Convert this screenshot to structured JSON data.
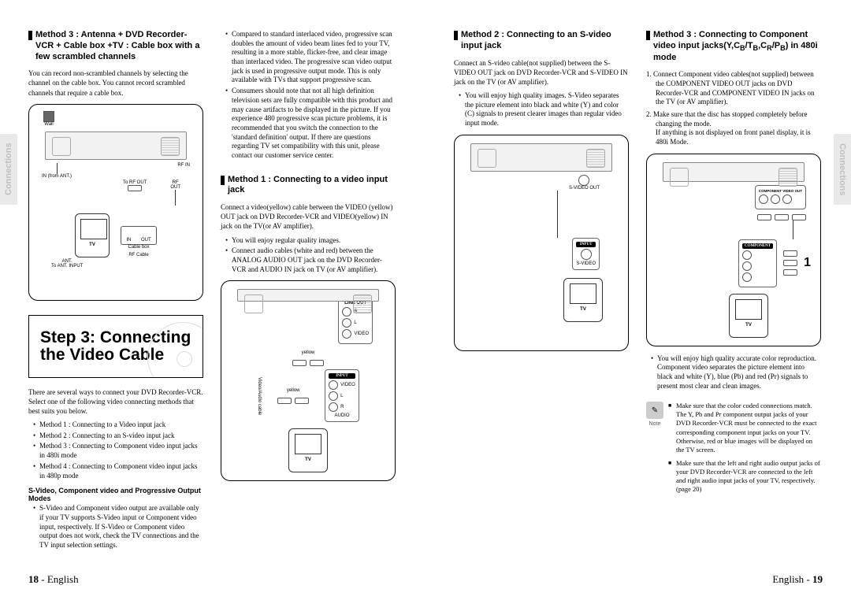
{
  "sideTab": "Connections",
  "pageLeftNum": "18",
  "pageRightNum": "19",
  "pageLang": "English",
  "left": {
    "col1": {
      "heading": "Method 3 : Antenna + DVD Recorder-VCR + Cable box +TV : Cable box with a few scrambled channels",
      "para": "You can record non-scrambled channels by selecting the channel on the cable box. You cannot record scrambled channels that require a cable box.",
      "fig": {
        "wall": "Wall",
        "in_label": "IN (from ANT.)",
        "rfin": "RF IN",
        "rf": "RF",
        "torf": "To RF OUT",
        "out": "OUT",
        "rfcable": "RF Cable",
        "cablebox": "Cable box",
        "in": "IN",
        "out2": "OUT",
        "tv": "TV",
        "ant": "ANT.",
        "toant": "To ANT. INPUT"
      },
      "stepTitle": "Step 3: Connecting the Video Cable",
      "para2": "There are several ways to connect your DVD Recorder-VCR. Select one of the following video connecting methods that best suits you below.",
      "methods": [
        "Method 1 : Connecting to a Video input jack",
        "Method 2 : Connecting to an S-video input jack",
        "Method 3 : Connecting to Component video input jacks in 480i mode",
        "Method 4 : Connecting to Component video input jacks in 480p mode"
      ],
      "subhead": "S-Video, Component video and Progressive Output Modes",
      "subbullets": [
        "S-Video and Component video output are available only if your TV supports S-Video input or Component video input, respectively. If S-Video or Component video output does not work, check the TV connections and the TV input selection settings."
      ]
    },
    "col2": {
      "bullets1": [
        "Compared to standard interlaced video, progressive scan doubles the amount of video beam lines fed to your TV, resulting in a more stable, flicker-free, and clear image than interlaced video. The progressive scan video output jack is used in progressive output mode. This is only available with TVs that support progressive scan.",
        "Consumers should note that not all high definition television sets are fully compatible with this product and may cause artifacts to be displayed in the picture. If you experience 480 progressive scan picture problems, it is recommended that you switch the connection to the 'standard definition' output. If there are questions regarding TV set compatibility with this unit, please contact our customer service center."
      ],
      "heading": "Method 1 : Connecting to a video input jack",
      "para": "Connect a video(yellow) cable between the VIDEO (yellow) OUT jack on DVD Recorder-VCR and VIDEO(yellow) IN jack on the TV(or AV amplifier).",
      "bullets2": [
        "You will enjoy regular quality images.",
        "Connect audio cables (white and red) between the ANALOG AUDIO OUT jack on the DVD Recorder-VCR and AUDIO IN jack on TV (or AV amplifier)."
      ],
      "fig": {
        "yellow": "yellow",
        "videoaudio": "Video/Audio cable",
        "lineout": "LINE OUT",
        "input": "INPUT",
        "video": "VIDEO",
        "l": "L",
        "r": "R",
        "audio": "AUDIO",
        "tv": "TV"
      }
    }
  },
  "right": {
    "col1": {
      "heading": "Method 2 : Connecting to an S-video input jack",
      "para": "Connect an S-video cable(not supplied) between the S-VIDEO OUT jack on DVD Recorder-VCR and S-VIDEO IN jack on the TV (or AV amplifier).",
      "bullets": [
        "You will enjoy high quality images. S-Video separates the picture element into black and white (Y) and color (C) signals to present clearer images than regular video input mode."
      ],
      "fig": {
        "svideoout": "S-VIDEO OUT",
        "input": "INPUT",
        "svideo": "S-VIDEO",
        "tv": "TV"
      }
    },
    "col2": {
      "heading_a": "Method 3 : Connecting to  Component video input jacks(Y,C",
      "heading_b": "B",
      "heading_c": "/T",
      "heading_d": "B",
      "heading_e": ",C",
      "heading_f": "R",
      "heading_g": "/P",
      "heading_h": "B",
      "heading_i": ") in 480i mode",
      "steps": [
        "1. Connect Component video cables(not supplied) between the COMPONENT VIDEO OUT jacks on DVD Recorder-VCR and COMPONENT VIDEO IN jacks on the TV (or AV amplifier).",
        "2. Make sure that the disc has stopped  completely before changing the mode."
      ],
      "step2note": "If anything is not displayed on front panel display, it is 480i Mode.",
      "fig": {
        "component_out": "COMPONENT VIDEO OUT",
        "component": "COMPONENT",
        "one": "1",
        "tv": "TV"
      },
      "bullets": [
        "You will enjoy high quality accurate color reproduction. Component video separates the picture element into black and white (Y), blue (Pb) and red (Pr) signals to present most clear and clean images."
      ],
      "noteLabel": "Note",
      "notes": [
        "Make sure that the color coded connections match. The Y, Pb and Pr component output jacks of your DVD Recorder-VCR must be connected to the exact corresponding component input jacks on your TV. Otherwise, red or blue images will be displayed on the TV screen.",
        "Make sure that the left and right audio output jacks of your DVD Recorder-VCR are connected to the left and right audio input jacks of your TV, respectively.(page 20)"
      ]
    }
  }
}
